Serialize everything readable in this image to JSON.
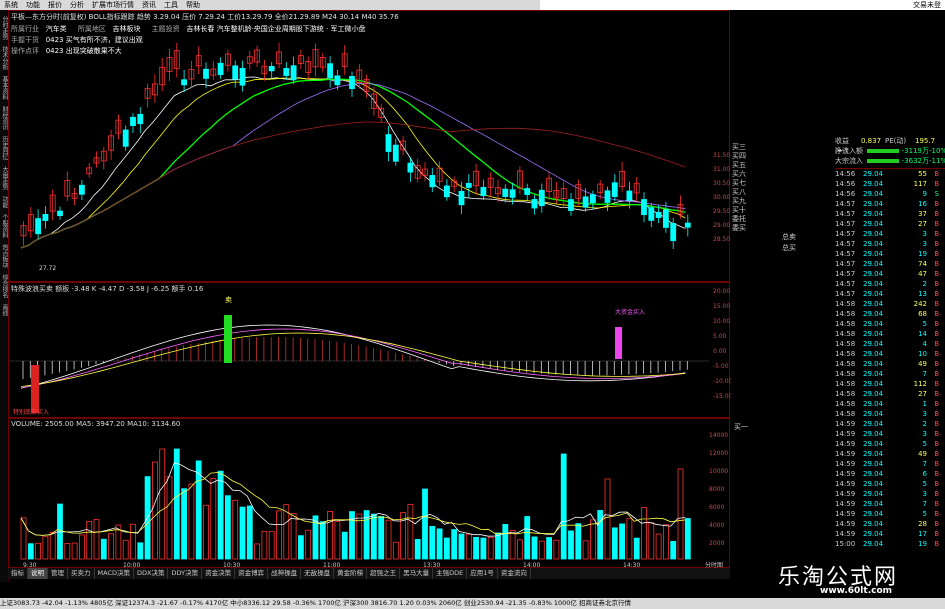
{
  "menu": {
    "items": [
      "系统",
      "功能",
      "报价",
      "分析",
      "扩展市场行情",
      "资讯",
      "工具",
      "帮助"
    ],
    "right_label": "交易未登"
  },
  "left_strip": {
    "items": [
      "分时走势",
      "技术分析",
      "基本资料",
      "财经资讯",
      "历史回忆",
      "大盘走势",
      "功能",
      "个股资料",
      "热点板块",
      "综合排名",
      "画线"
    ]
  },
  "main": {
    "title_line": "平板—东方分时(前复权) BOLL指标跟踪 趋势 3.29.04  压价 7.29.24  工价13.29.79  全价21.29.89  M24 30.14  M40 35.76",
    "info_rows": [
      {
        "label": "所属行业",
        "value": "汽车类",
        "label2": "所属地区",
        "value2": "吉林板块",
        "label3": "主题投资",
        "value3": "吉林长春 汽车整机龄·央国企业周期股下游统 · 军工微小盘"
      },
      {
        "label": "手握干货",
        "value": "0423  买气有所不济，建议出观"
      },
      {
        "label": "操作点评",
        "value": "0423  出现突破散果不大"
      }
    ],
    "price_labels": [
      "31.50",
      "31.00",
      "30.50",
      "30.00",
      "29.50",
      "29.00",
      "28.50"
    ],
    "low_label": "27.72",
    "side_labels": [
      "买三",
      "买四",
      "买五",
      "买六",
      "买七",
      "买八",
      "买九",
      "买十",
      "委托",
      "委买"
    ],
    "side_values": [
      "总卖",
      "总买"
    ]
  },
  "indicator": {
    "title": "特殊波浪买卖 额板 -3.48  K -4.47  D -3.58  J -6.25  额手 0.16",
    "sell_label": "卖",
    "buy_label": "大资金买入",
    "bottom_label": "特别底部买入",
    "axis": [
      "20.00",
      "15.00",
      "10.00",
      "5.00",
      "0.00",
      "-5.00",
      "-10.00",
      "-15.00"
    ]
  },
  "volume": {
    "title": "VOLUME: 2505.00  MA5: 3947.20  MA10: 3134.60",
    "axis": [
      "14000",
      "12000",
      "10000",
      "8000",
      "6000",
      "4000",
      "2000"
    ],
    "x_labels": [
      "9:30",
      "10:00",
      "10:30",
      "11:00",
      "13:30",
      "14:00",
      "14:30"
    ],
    "extra_label": "分时图"
  },
  "quote": {
    "header": {
      "label": "收益(一)",
      "value": "0.837",
      "label2": "PE(动)",
      "value2": "195.7"
    },
    "flow": [
      {
        "label": "净流入额",
        "value": "-3119万",
        "pct": "-10%"
      },
      {
        "label": "大宗流入",
        "value": "-3632万",
        "pct": "-11%"
      }
    ],
    "rows": [
      {
        "t": "14:56",
        "p": "29.04",
        "v": "55",
        "f": "B"
      },
      {
        "t": "14:56",
        "p": "29.04",
        "v": "117",
        "f": "B"
      },
      {
        "t": "14:56",
        "p": "29.04",
        "v": "9",
        "f": "S"
      },
      {
        "t": "14:57",
        "p": "29.04",
        "v": "16",
        "f": "B"
      },
      {
        "t": "14:57",
        "p": "29.04",
        "v": "37",
        "f": "B"
      },
      {
        "t": "14:57",
        "p": "29.04",
        "v": "27",
        "f": "B"
      },
      {
        "t": "14:57",
        "p": "29.04",
        "v": "3",
        "f": "B"
      },
      {
        "t": "14:57",
        "p": "29.04",
        "v": "3",
        "f": "B"
      },
      {
        "t": "14:57",
        "p": "29.04",
        "v": "19",
        "f": "B"
      },
      {
        "t": "14:57",
        "p": "29.04",
        "v": "74",
        "f": "B"
      },
      {
        "t": "14:57",
        "p": "29.04",
        "v": "47",
        "f": "B"
      },
      {
        "t": "14:57",
        "p": "29.04",
        "v": "2",
        "f": "B"
      },
      {
        "t": "14:57",
        "p": "29.04",
        "v": "13",
        "f": "B"
      },
      {
        "t": "14:58",
        "p": "29.04",
        "v": "242",
        "f": "B"
      },
      {
        "t": "14:58",
        "p": "29.04",
        "v": "68",
        "f": "B"
      },
      {
        "t": "14:58",
        "p": "29.04",
        "v": "5",
        "f": "B"
      },
      {
        "t": "14:58",
        "p": "29.04",
        "v": "14",
        "f": "B"
      },
      {
        "t": "14:58",
        "p": "29.04",
        "v": "4",
        "f": "B"
      },
      {
        "t": "14:58",
        "p": "29.04",
        "v": "10",
        "f": "B"
      },
      {
        "t": "14:58",
        "p": "29.04",
        "v": "49",
        "f": "B"
      },
      {
        "t": "14:58",
        "p": "29.04",
        "v": "7",
        "f": "B"
      },
      {
        "t": "14:58",
        "p": "29.04",
        "v": "112",
        "f": "B"
      },
      {
        "t": "14:58",
        "p": "29.04",
        "v": "27",
        "f": "B"
      },
      {
        "t": "14:58",
        "p": "29.04",
        "v": "1",
        "f": "B"
      },
      {
        "t": "14:58",
        "p": "29.04",
        "v": "3",
        "f": "B"
      },
      {
        "t": "14:59",
        "p": "29.04",
        "v": "2",
        "f": "B"
      },
      {
        "t": "14:59",
        "p": "29.04",
        "v": "3",
        "f": "B"
      },
      {
        "t": "14:59",
        "p": "29.04",
        "v": "5",
        "f": "B"
      },
      {
        "t": "14:59",
        "p": "29.04",
        "v": "49",
        "f": "B"
      },
      {
        "t": "14:59",
        "p": "29.04",
        "v": "7",
        "f": "B"
      },
      {
        "t": "14:59",
        "p": "29.04",
        "v": "6",
        "f": "B"
      },
      {
        "t": "14:59",
        "p": "29.04",
        "v": "5",
        "f": "B"
      },
      {
        "t": "14:59",
        "p": "29.04",
        "v": "3",
        "f": "B"
      },
      {
        "t": "14:59",
        "p": "29.04",
        "v": "7",
        "f": "B"
      },
      {
        "t": "14:59",
        "p": "29.04",
        "v": "5",
        "f": "B"
      },
      {
        "t": "14:59",
        "p": "29.04",
        "v": "28",
        "f": "B"
      },
      {
        "t": "14:59",
        "p": "29.04",
        "v": "17",
        "f": "B"
      },
      {
        "t": "15:00",
        "p": "29.04",
        "v": "19",
        "f": "B"
      }
    ],
    "side_label": "买一"
  },
  "tabs": {
    "items": [
      "指标",
      "说明",
      "管理",
      "买卖力",
      "MACD决策",
      "DDX决策",
      "DDY决策",
      "资金决策",
      "资金博弈",
      "战神操盘",
      "无敌操盘",
      "黄金阶梯",
      "超强之王",
      "黑马大量",
      "主强DDE",
      "应用1号",
      "资金流向"
    ]
  },
  "status": {
    "text": "上证3083.73 -42.04 -1.13% 4805亿  深证12374.3 -21.67 -0.17% 4170亿  中小8336.12 29.58 -0.36% 1700亿  沪深300 3816.70 1.20 0.03% 2060亿  创业2530.94 -21.35 -0.83% 1000亿  招商证券北京行情"
  },
  "watermark": {
    "text": "乐淘公式网",
    "url": "www.60lt.com"
  },
  "colors": {
    "up": "#ff3030",
    "down": "#00ffff",
    "ma_white": "#ffffff",
    "ma_yellow": "#ffff00",
    "ma_green": "#00ff00",
    "ma_purple": "#a070ff",
    "ma_red": "#a02020",
    "border": "#700000"
  }
}
